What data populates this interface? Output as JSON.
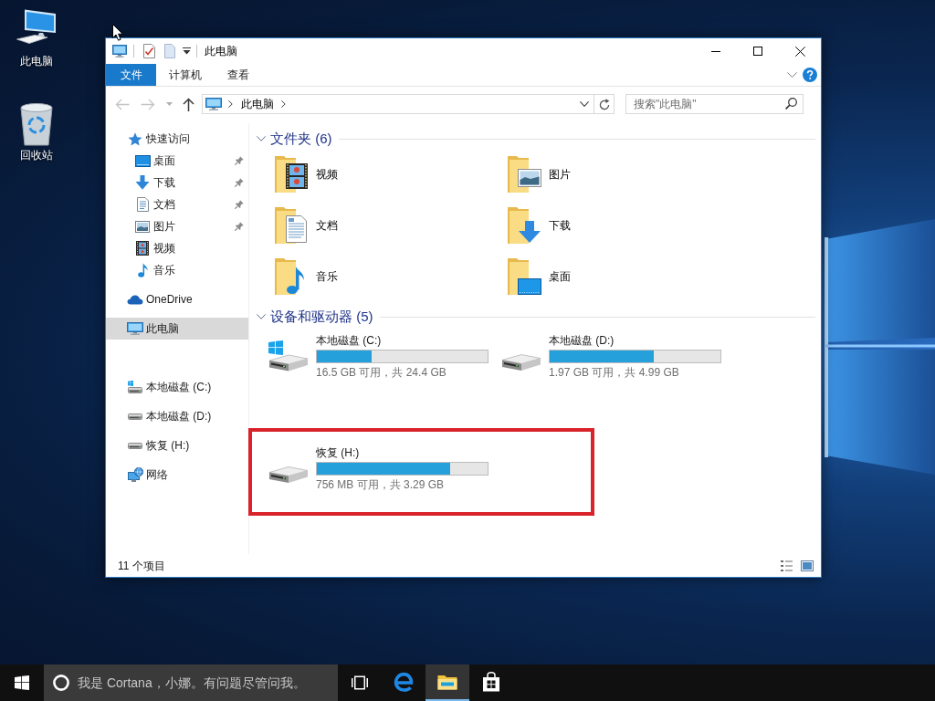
{
  "desktop_icons": [
    {
      "label": "此电脑"
    },
    {
      "label": "回收站"
    }
  ],
  "window": {
    "title": "此电脑",
    "ribbon_tabs": [
      {
        "label": "文件",
        "kind": "file"
      },
      {
        "label": "计算机",
        "kind": "tab"
      },
      {
        "label": "查看",
        "kind": "tab"
      }
    ],
    "navigation": {
      "back": {
        "disabled": true
      },
      "forward": {
        "disabled": true
      },
      "up": {
        "disabled": false
      }
    },
    "address_bar": {
      "path": [
        "此电脑"
      ]
    },
    "search": {
      "placeholder": "搜索\"此电脑\""
    },
    "nav_pane": {
      "sections": [
        {
          "items": [
            {
              "label": "快速访问",
              "selected": false,
              "children": [
                {
                  "label": "桌面",
                  "pinned": true,
                  "selected": false
                },
                {
                  "label": "下载",
                  "pinned": true,
                  "selected": false
                },
                {
                  "label": "文档",
                  "pinned": true,
                  "selected": false
                },
                {
                  "label": "图片",
                  "pinned": true,
                  "selected": false
                },
                {
                  "label": "视频",
                  "pinned": false,
                  "selected": false
                },
                {
                  "label": "音乐",
                  "pinned": false,
                  "selected": false
                }
              ]
            },
            {
              "label": "OneDrive",
              "selected": false
            },
            {
              "label": "此电脑",
              "selected": true
            }
          ]
        },
        {
          "items": [
            {
              "label": "本地磁盘 (C:)",
              "selected": false
            },
            {
              "label": "本地磁盘 (D:)",
              "selected": false
            },
            {
              "label": "恢复 (H:)",
              "selected": false
            },
            {
              "label": "网络",
              "selected": false
            }
          ]
        }
      ]
    },
    "groups": [
      {
        "title": "文件夹 (6)",
        "kind": "folders",
        "expanded": true,
        "items": [
          {
            "label": "视频"
          },
          {
            "label": "图片"
          },
          {
            "label": "文档"
          },
          {
            "label": "下载"
          },
          {
            "label": "音乐"
          },
          {
            "label": "桌面"
          }
        ]
      },
      {
        "title": "设备和驱动器 (5)",
        "kind": "drives",
        "expanded": true,
        "items": [
          {
            "label": "本地磁盘 (C:)",
            "level": 0.32,
            "caption": "16.5 GB 可用，共 24.4 GB",
            "highlighted": false
          },
          {
            "label": "本地磁盘 (D:)",
            "level": 0.61,
            "caption": "1.97 GB 可用，共 4.99 GB",
            "highlighted": false
          },
          {
            "label": "恢复 (H:)",
            "level": 0.78,
            "caption": "756 MB 可用，共 3.29 GB",
            "highlighted": true
          }
        ]
      }
    ],
    "status_bar": {
      "item_count": "11 个项目"
    }
  },
  "taskbar": {
    "search": {
      "placeholder": "我是 Cortana，小娜。有问题尽管问我。"
    },
    "pinned_apps": [
      {
        "active": false
      },
      {
        "active": true
      },
      {
        "active": false
      }
    ]
  }
}
